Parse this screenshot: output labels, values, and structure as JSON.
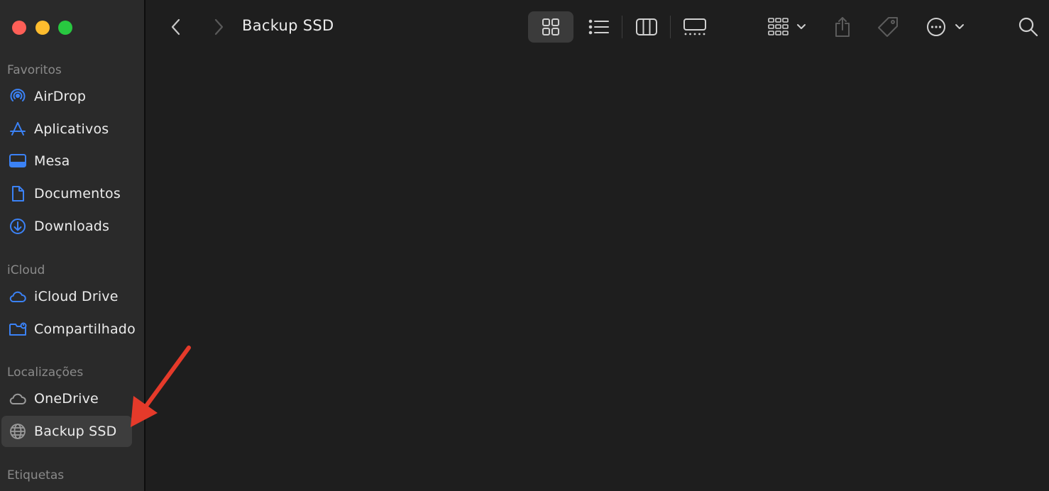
{
  "window": {
    "title": "Backup SSD"
  },
  "toolbar": {
    "back_icon": "chevron-left-icon",
    "forward_icon": "chevron-right-icon",
    "views": [
      "icon-grid-view",
      "list-view",
      "column-view",
      "gallery-view"
    ],
    "active_view": "icon-grid-view",
    "group_icon": "group-by-icon",
    "share_icon": "share-icon",
    "tag_icon": "tag-icon",
    "more_icon": "ellipsis-circle-icon",
    "search_icon": "search-icon"
  },
  "sidebar": {
    "sections": [
      {
        "title": "Favoritos",
        "items": [
          {
            "label": "AirDrop",
            "icon": "airdrop-icon"
          },
          {
            "label": "Aplicativos",
            "icon": "applications-icon"
          },
          {
            "label": "Mesa",
            "icon": "desktop-icon"
          },
          {
            "label": "Documentos",
            "icon": "document-icon"
          },
          {
            "label": "Downloads",
            "icon": "download-icon"
          }
        ]
      },
      {
        "title": "iCloud",
        "items": [
          {
            "label": "iCloud Drive",
            "icon": "cloud-icon"
          },
          {
            "label": "Compartilhado",
            "icon": "shared-folder-icon"
          }
        ]
      },
      {
        "title": "Localizações",
        "items": [
          {
            "label": "OneDrive",
            "icon": "cloud-icon"
          },
          {
            "label": "Backup SSD",
            "icon": "globe-icon",
            "selected": true
          }
        ]
      },
      {
        "title": "Etiquetas",
        "items": []
      }
    ]
  },
  "colors": {
    "accent": "#3b82f6",
    "sidebar_bg": "#2a2a2a",
    "content_bg": "#1e1e1e",
    "annotation_arrow": "#e53a2a",
    "close": "#fe5f57",
    "minimize": "#febc2e",
    "maximize": "#28c840"
  }
}
